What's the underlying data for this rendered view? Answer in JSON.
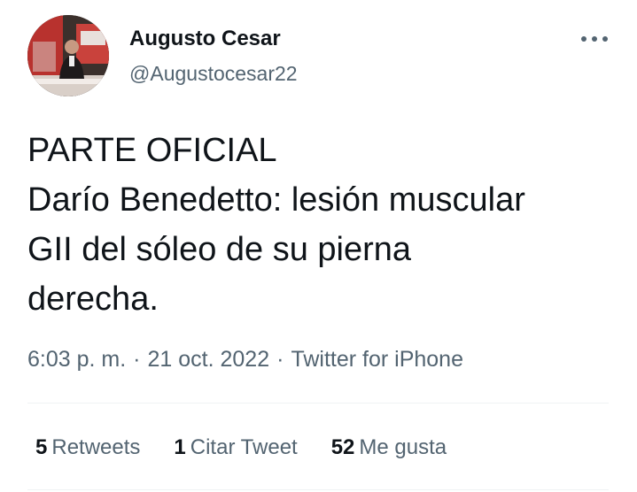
{
  "author": {
    "name": "Augusto Cesar",
    "handle": "@Augustocesar22"
  },
  "icons": {
    "avatar": "profile-photo",
    "more": "more-options-icon"
  },
  "tweet": {
    "lines": [
      "PARTE OFICIAL",
      "Darío Benedetto: lesión muscular",
      "GII del sóleo de su pierna",
      "derecha."
    ]
  },
  "meta": {
    "time": "6:03 p. m.",
    "separator": "·",
    "date": "21 oct. 2022",
    "source": "Twitter for iPhone"
  },
  "stats": {
    "retweets": {
      "count": "5",
      "label": "Retweets"
    },
    "quotes": {
      "count": "1",
      "label": "Citar Tweet"
    },
    "likes": {
      "count": "52",
      "label": "Me gusta"
    }
  },
  "colors": {
    "text": "#0f1419",
    "secondary": "#536471",
    "divider": "#eff3f4"
  }
}
